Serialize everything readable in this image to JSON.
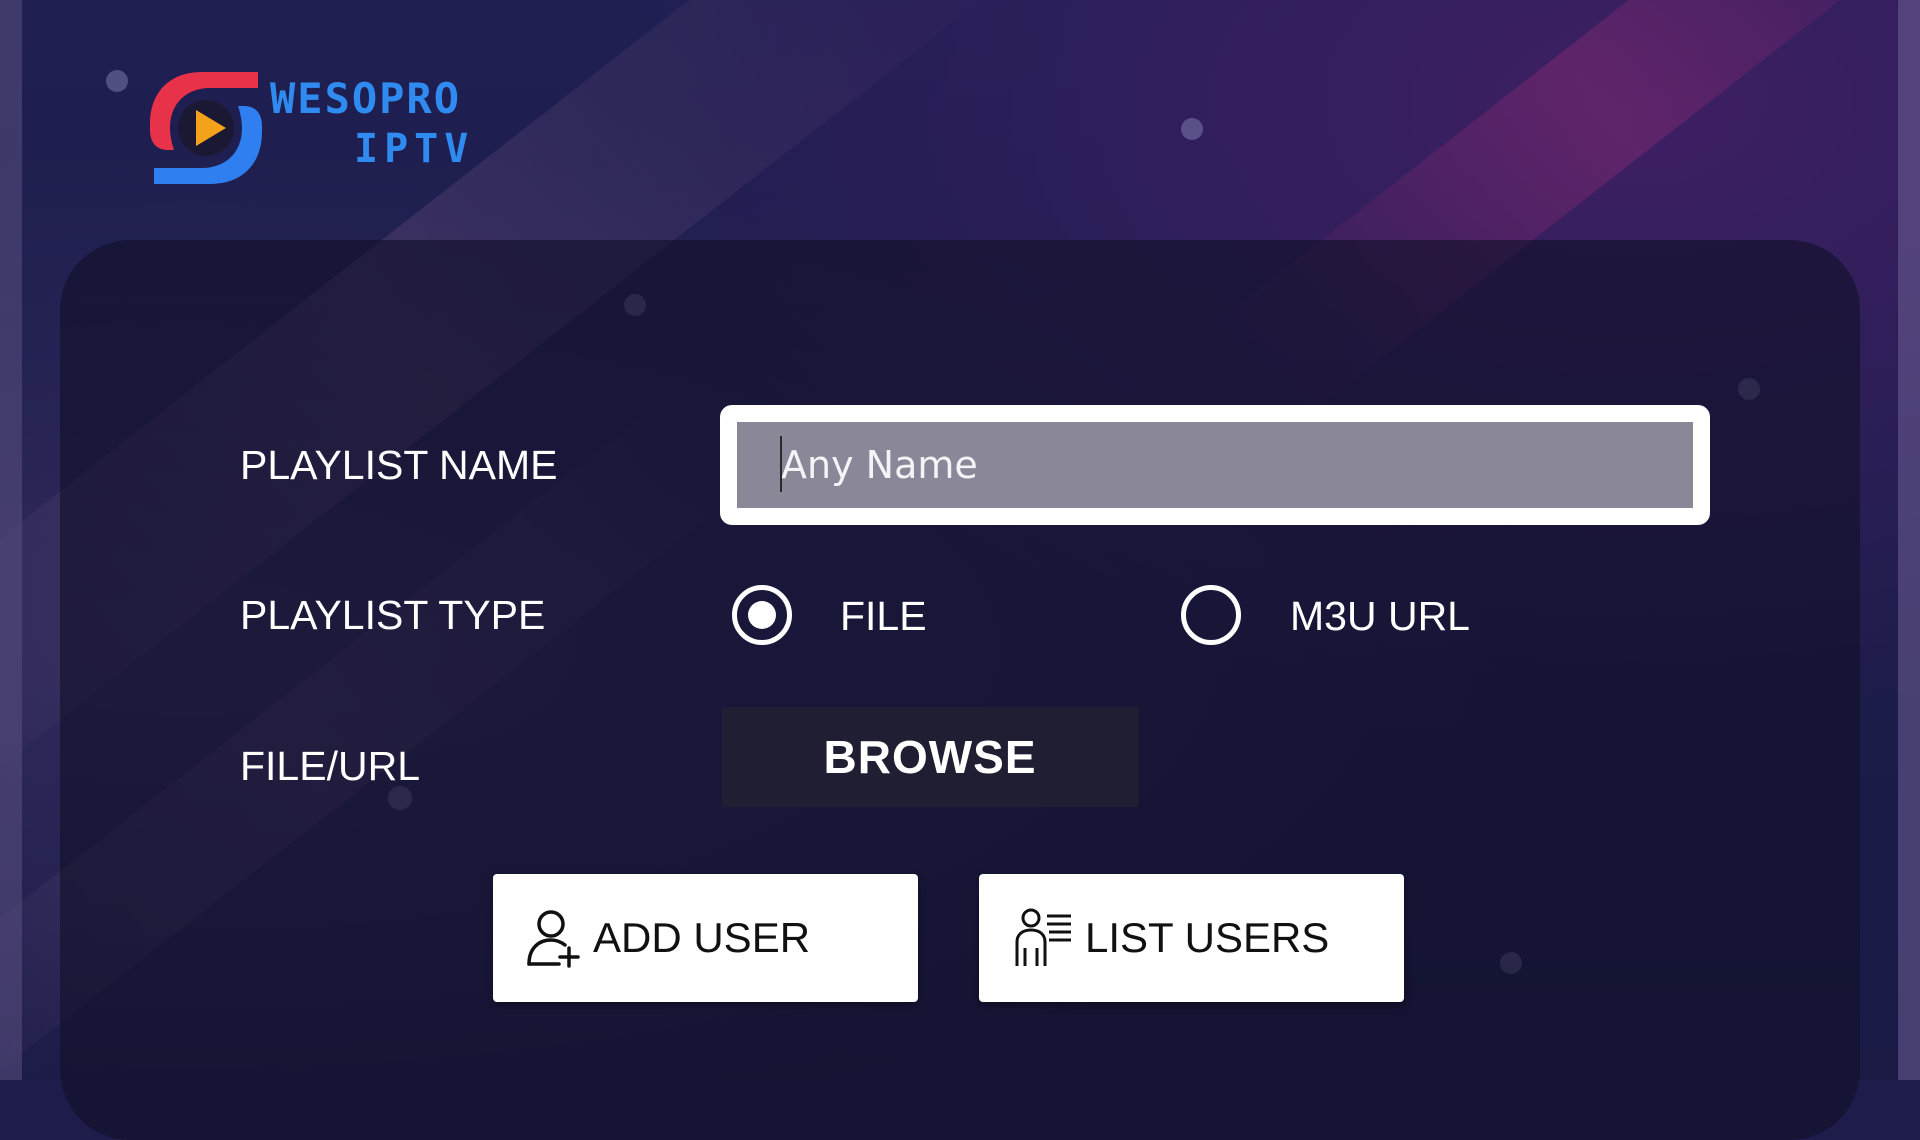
{
  "brand": {
    "line1": "WESOPRO",
    "line2": "IPTV",
    "colors": {
      "blue": "#2f8bf0",
      "red": "#e8324a",
      "orange": "#f5a21b"
    }
  },
  "form": {
    "playlist_name_label": "PLAYLIST NAME",
    "playlist_name_placeholder": "Any Name",
    "playlist_type_label": "PLAYLIST TYPE",
    "type_options": [
      {
        "label": "FILE",
        "selected": true
      },
      {
        "label": "M3U URL",
        "selected": false
      }
    ],
    "file_url_label": "FILE/URL",
    "browse_label": "BROWSE"
  },
  "actions": {
    "add_user": {
      "label": "ADD USER",
      "icon": "add-user-icon"
    },
    "list_users": {
      "label": "LIST USERS",
      "icon": "list-users-icon"
    }
  }
}
